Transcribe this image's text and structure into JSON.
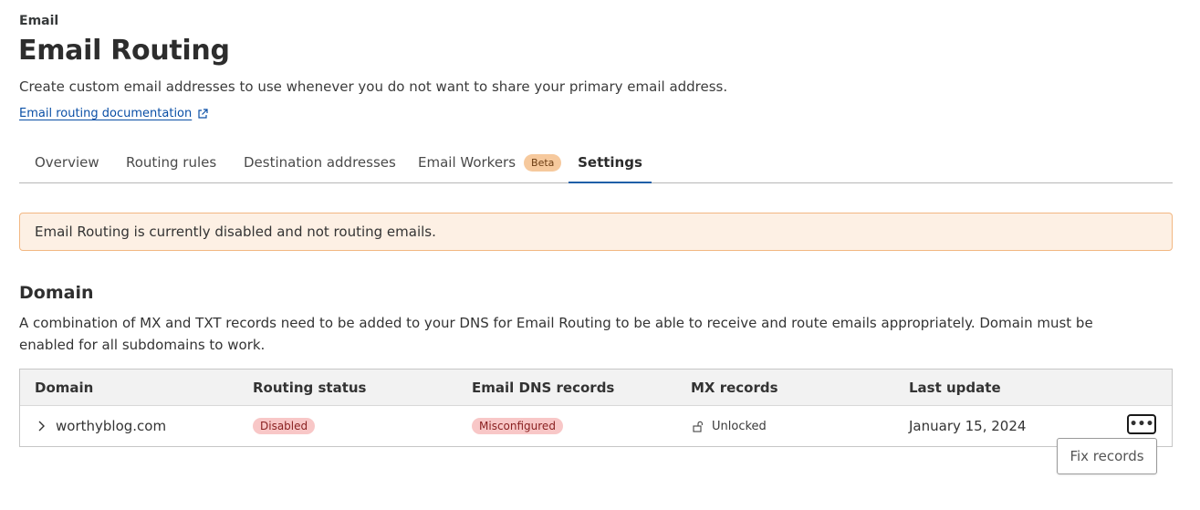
{
  "breadcrumb": "Email",
  "page": {
    "title": "Email Routing",
    "subtitle": "Create custom email addresses to use whenever you do not want to share your primary email address.",
    "doc_link": "Email routing documentation"
  },
  "tabs": [
    {
      "label": "Overview"
    },
    {
      "label": "Routing rules"
    },
    {
      "label": "Destination addresses"
    },
    {
      "label": "Email Workers",
      "badge": "Beta"
    },
    {
      "label": "Settings",
      "active": true
    }
  ],
  "alert": {
    "message": "Email Routing is currently disabled and not routing emails."
  },
  "domain_section": {
    "title": "Domain",
    "description": "A combination of MX and TXT records need to be added to your DNS for Email Routing to be able to receive and route emails appropriately. Domain must be enabled for all subdomains to work."
  },
  "table": {
    "headers": [
      "Domain",
      "Routing status",
      "Email DNS records",
      "MX records",
      "Last update"
    ],
    "rows": [
      {
        "domain": "worthyblog.com",
        "routing_status": "Disabled",
        "dns_records": "Misconfigured",
        "mx_records": "Unlocked",
        "last_update": "January 15, 2024"
      }
    ]
  },
  "actions_menu": {
    "kebab_label": "•••",
    "items": [
      "Fix records"
    ]
  },
  "colors": {
    "link": "#0a4fa6",
    "tab_active": "#1f5fa8",
    "beta_badge": "#f6c99d",
    "alert_bg": "#fdf0e4",
    "alert_border": "#f2b782",
    "error_pill": "#f8c7c7"
  },
  "icons": {
    "external_link": "external-link-icon",
    "expand": "chevron-right-icon",
    "lock": "unlock-icon",
    "more": "more-options-icon"
  }
}
